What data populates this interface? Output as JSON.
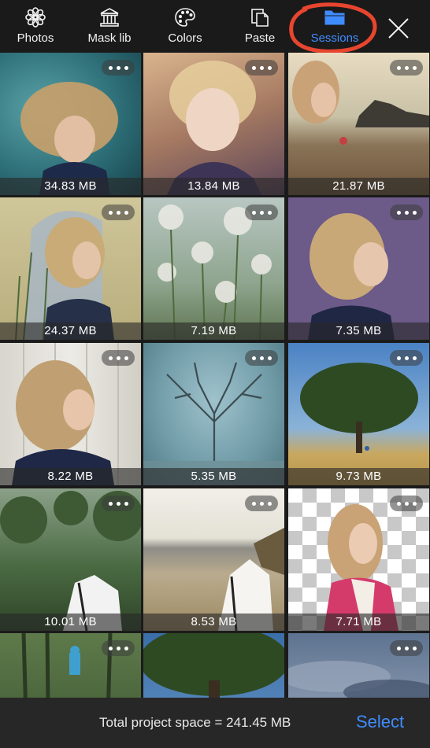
{
  "toolbar": {
    "items": [
      {
        "label": "Photos",
        "icon": "flower-icon"
      },
      {
        "label": "Mask lib",
        "icon": "museum-icon"
      },
      {
        "label": "Colors",
        "icon": "palette-icon"
      },
      {
        "label": "Paste",
        "icon": "clipboard-icon"
      },
      {
        "label": "Sessions",
        "icon": "folder-icon",
        "active": true
      }
    ],
    "close_icon": "close-icon",
    "active_color": "#3f8cff",
    "highlight_color": "#e8452f"
  },
  "sessions": [
    {
      "size": "34.83 MB"
    },
    {
      "size": "13.84 MB"
    },
    {
      "size": "21.87 MB"
    },
    {
      "size": "24.37 MB"
    },
    {
      "size": "7.19 MB"
    },
    {
      "size": "7.35 MB"
    },
    {
      "size": "8.22 MB"
    },
    {
      "size": "5.35 MB"
    },
    {
      "size": "9.73 MB"
    },
    {
      "size": "10.01 MB"
    },
    {
      "size": "8.53 MB"
    },
    {
      "size": "7.71 MB"
    },
    {
      "size": ""
    },
    {
      "size": ""
    },
    {
      "size": ""
    }
  ],
  "footer": {
    "total_text": "Total project space = 241.45 MB",
    "select_label": "Select"
  }
}
